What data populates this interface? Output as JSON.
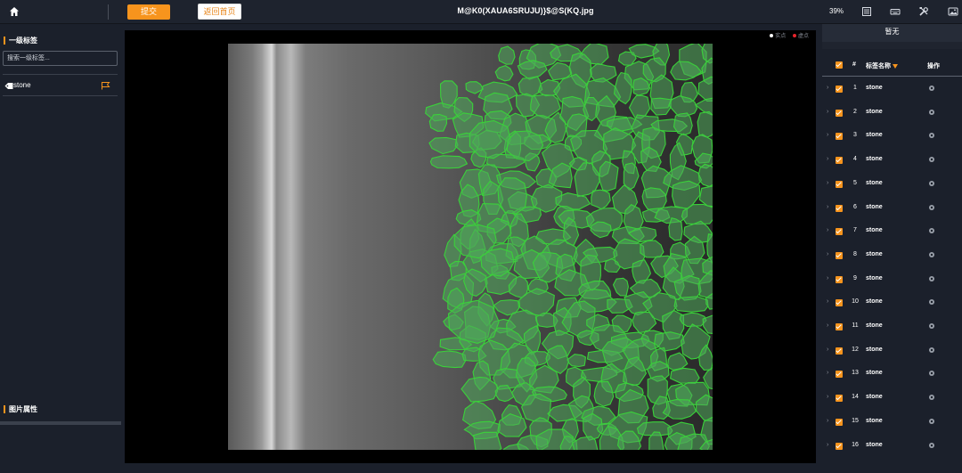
{
  "topbar": {
    "submit_label": "提交",
    "back_label": "返回首页",
    "file_name": "M@K0(XAUA6SRUJU)}$@S(KQ.jpg",
    "zoom": "39%"
  },
  "left": {
    "labels_title": "一级标签",
    "search_placeholder": "搜索一级标签...",
    "labels": [
      {
        "name": "stone"
      }
    ],
    "image_props_title": "图片属性"
  },
  "canvas": {
    "legend_solid": "实点",
    "legend_empty": "虚点"
  },
  "right": {
    "top_text": "暂无",
    "header": {
      "index": "#",
      "label_name": "标签名称",
      "action": "操作"
    },
    "rows": [
      {
        "index": "1",
        "name": "stone"
      },
      {
        "index": "2",
        "name": "stone"
      },
      {
        "index": "3",
        "name": "stone"
      },
      {
        "index": "4",
        "name": "stone"
      },
      {
        "index": "5",
        "name": "stone"
      },
      {
        "index": "6",
        "name": "stone"
      },
      {
        "index": "7",
        "name": "stone"
      },
      {
        "index": "8",
        "name": "stone"
      },
      {
        "index": "9",
        "name": "stone"
      },
      {
        "index": "10",
        "name": "stone"
      },
      {
        "index": "11",
        "name": "stone"
      },
      {
        "index": "12",
        "name": "stone"
      },
      {
        "index": "13",
        "name": "stone"
      },
      {
        "index": "14",
        "name": "stone"
      },
      {
        "index": "15",
        "name": "stone"
      },
      {
        "index": "16",
        "name": "stone"
      }
    ]
  },
  "colors": {
    "accent": "#f7941d",
    "annotation_stroke": "#3ad13a",
    "annotation_fill": "#4fa85a"
  },
  "icons": [
    "home-icon",
    "list-icon",
    "keyboard-icon",
    "tools-icon",
    "image-icon",
    "tag-icon",
    "flag-icon",
    "gear-icon",
    "chevron-right-icon",
    "checkbox-icon",
    "sort-down-icon"
  ]
}
